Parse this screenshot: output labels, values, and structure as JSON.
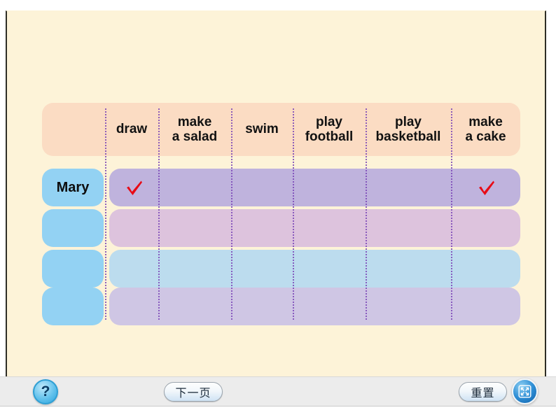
{
  "slide": {
    "background_color": "#fdf3d8",
    "border_color": "#2e2e26"
  },
  "table": {
    "header_background": "#fbdcc3",
    "divider_color": "#7c48b8",
    "name_pill_color": "#93d2f3",
    "corner_label": "",
    "columns": [
      {
        "key": "draw",
        "label": "draw"
      },
      {
        "key": "salad",
        "label": "make\na salad"
      },
      {
        "key": "swim",
        "label": "swim"
      },
      {
        "key": "football",
        "label": "play\nfootball"
      },
      {
        "key": "basketball",
        "label": "play\nbasketball"
      },
      {
        "key": "cake",
        "label": "make\na cake"
      }
    ],
    "rows": [
      {
        "name": "Mary",
        "strip_color": "#bfb3dd",
        "checks": {
          "draw": true,
          "salad": false,
          "swim": false,
          "football": false,
          "basketball": false,
          "cake": true
        }
      },
      {
        "name": "",
        "strip_color": "#ddc3dd",
        "checks": {
          "draw": false,
          "salad": false,
          "swim": false,
          "football": false,
          "basketball": false,
          "cake": false
        }
      },
      {
        "name": "",
        "strip_color": "#bcdcee",
        "checks": {
          "draw": false,
          "salad": false,
          "swim": false,
          "football": false,
          "basketball": false,
          "cake": false
        }
      },
      {
        "name": "",
        "strip_color": "#cfc6e4",
        "checks": {
          "draw": false,
          "salad": false,
          "swim": false,
          "football": false,
          "basketball": false,
          "cake": false
        }
      }
    ],
    "check_color": "#e80b16"
  },
  "toolbar": {
    "background": "#ececec",
    "help_label": "?",
    "next_label": "下一页",
    "reset_label": "重置",
    "fullscreen_icon": "fullscreen-expand-icon"
  }
}
